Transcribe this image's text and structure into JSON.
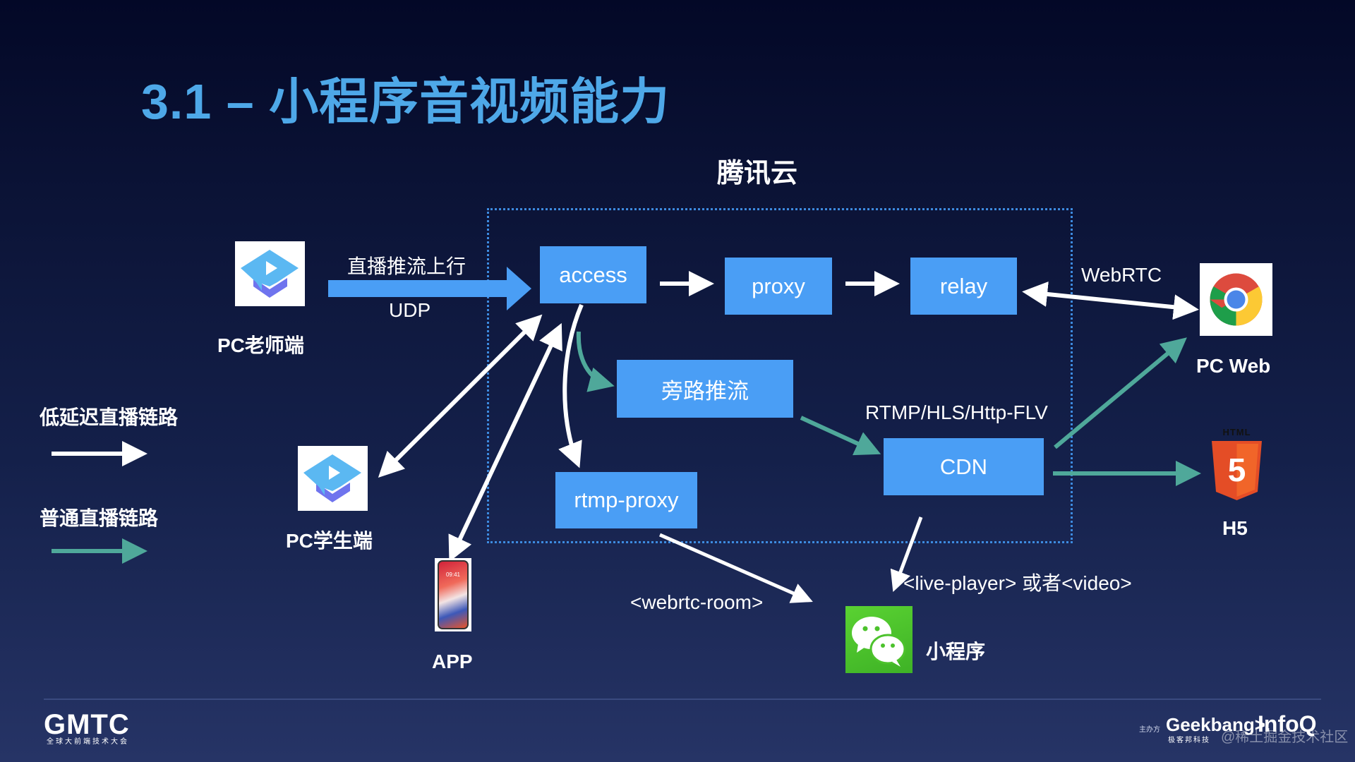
{
  "slide": {
    "title": "3.1 – 小程序音视频能力",
    "cloud_title": "腾讯云"
  },
  "nodes": {
    "access": "access",
    "proxy": "proxy",
    "relay": "relay",
    "bypass": "旁路推流",
    "cdn": "CDN",
    "rtmp_proxy": "rtmp-proxy"
  },
  "endpoints": {
    "pc_teacher": "PC老师端",
    "pc_student": "PC学生端",
    "app": "APP",
    "app_screen_time": "09:41",
    "mini_program": "小程序",
    "pc_web": "PC Web",
    "h5": "H5",
    "html_badge": "HTML",
    "html5_digit": "5"
  },
  "edge_labels": {
    "push_up": "直播推流上行",
    "udp": "UDP",
    "webrtc": "WebRTC",
    "cdn_protocols": "RTMP/HLS/Http-FLV",
    "webrtc_room": "<webrtc-room>",
    "live_player": "<live-player> 或者<video>"
  },
  "legend": {
    "low_latency": "低延迟直播链路",
    "normal": "普通直播链路"
  },
  "colors": {
    "title": "#4ea8e8",
    "node": "#4a9ef5",
    "low_latency_line": "#ffffff",
    "normal_line": "#4fa89a",
    "frame": "#3d8be0"
  },
  "footer": {
    "gmtc": "GMTC",
    "gmtc_sub": "全球大前端技术大会",
    "sponsor_label": "主办方",
    "geekbang": "Geekbang>.",
    "geekbang_sub": "极客邦科技",
    "infoq": "InfoQ",
    "watermark": "@稀土掘金技术社区"
  }
}
